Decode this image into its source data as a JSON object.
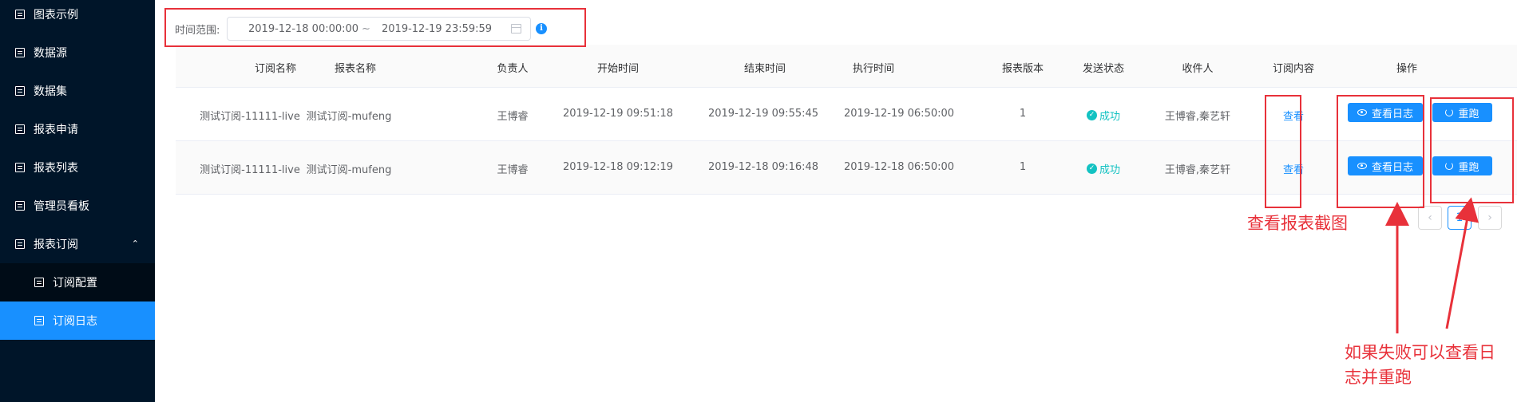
{
  "sidebar": {
    "items": [
      {
        "label": "图表示例"
      },
      {
        "label": "数据源"
      },
      {
        "label": "数据集"
      },
      {
        "label": "报表申请"
      },
      {
        "label": "报表列表"
      },
      {
        "label": "管理员看板"
      },
      {
        "label": "报表订阅",
        "expanded": true
      },
      {
        "label": "订阅配置"
      },
      {
        "label": "订阅日志",
        "active": true
      }
    ]
  },
  "filter": {
    "label": "时间范围:",
    "start": "2019-12-18 00:00:00",
    "separator": "~",
    "end": "2019-12-19 23:59:59"
  },
  "table": {
    "headers": [
      "订阅名称",
      "报表名称",
      "负责人",
      "开始时间",
      "结束时间",
      "执行时间",
      "报表版本",
      "发送状态",
      "收件人",
      "订阅内容",
      "操作"
    ],
    "rows": [
      {
        "subscription": "测试订阅-11111-live",
        "report": "测试订阅-mufeng",
        "owner": "王博睿",
        "start": "2019-12-19 09:51:18",
        "end": "2019-12-19 09:55:45",
        "exec": "2019-12-19 06:50:00",
        "version": "1",
        "status": "成功",
        "recipients": "王博睿,秦艺轩",
        "content_link": "查看",
        "log_button": "查看日志",
        "rerun_button": "重跑"
      },
      {
        "subscription": "测试订阅-11111-live",
        "report": "测试订阅-mufeng",
        "owner": "王博睿",
        "start": "2019-12-18 09:12:19",
        "end": "2019-12-18 09:16:48",
        "exec": "2019-12-18 06:50:00",
        "version": "1",
        "status": "成功",
        "recipients": "王博睿,秦艺轩",
        "content_link": "查看",
        "log_button": "查看日志",
        "rerun_button": "重跑"
      }
    ]
  },
  "pagination": {
    "prev": "‹",
    "current": "1",
    "next": "›"
  },
  "annotations": {
    "view_screenshot": "查看报表截图",
    "fail_note_line1": "如果失败可以查看日",
    "fail_note_line2": "志并重跑"
  },
  "colors": {
    "sidebar_bg": "#001529",
    "active": "#1890ff",
    "success": "#13c2c2",
    "annotation": "#e8313a"
  }
}
